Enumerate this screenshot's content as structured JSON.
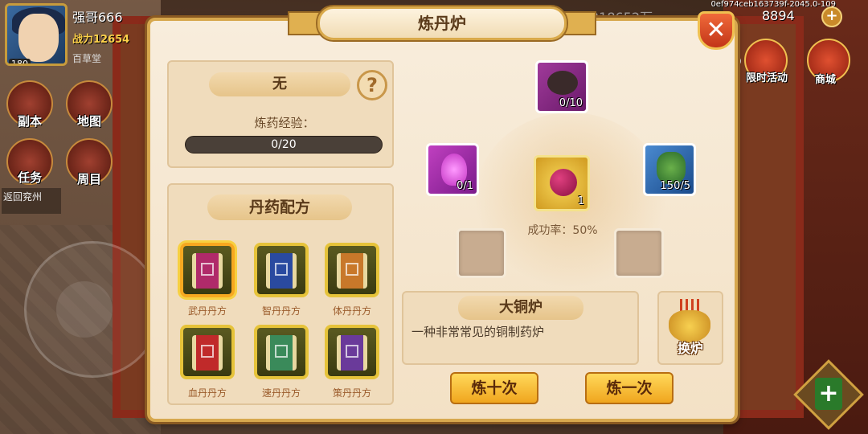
{
  "hud": {
    "player_name": "强哥666",
    "power_label": "战力12654",
    "guild": "百草堂",
    "level": "180",
    "debug_id": "0ef974ceb163739f-2045.0-109",
    "currency_1": "218652万",
    "currency_2": "8894",
    "return_label": "返回兖州",
    "side_buttons": [
      "副本",
      "地图",
      "任务",
      "周目"
    ],
    "right_buttons": [
      "限时活动",
      "商城"
    ]
  },
  "dialog": {
    "title": "炼丹炉",
    "close_icon": "close-icon",
    "current_recipe": "无",
    "help_icon": "?",
    "exp_label": "炼药经验：",
    "exp_value": "0/20",
    "exp_fraction": 0.0,
    "recipes_header": "丹药配方",
    "recipes": [
      {
        "label": "武丹丹方",
        "color": "#b02a6a",
        "selected": true
      },
      {
        "label": "智丹丹方",
        "color": "#2a4aa0",
        "selected": false
      },
      {
        "label": "体丹丹方",
        "color": "#c8782a",
        "selected": false
      },
      {
        "label": "血丹丹方",
        "color": "#c02a2a",
        "selected": false
      },
      {
        "label": "速丹丹方",
        "color": "#3a8a5a",
        "selected": false
      },
      {
        "label": "策丹丹方",
        "color": "#6a3a9a",
        "selected": false
      }
    ],
    "ingredients": {
      "top": {
        "count": "0/10",
        "icon": "ore-icon"
      },
      "left": {
        "count": "0/1",
        "icon": "purple-flame-icon"
      },
      "center": {
        "count": "1",
        "icon": "red-pill-icon"
      },
      "right": {
        "count": "150/5",
        "icon": "herb-icon"
      }
    },
    "success_rate": "成功率：50%",
    "furnace_name": "大铜炉",
    "furnace_desc": "一种非常常见的铜制药炉",
    "switch_label": "换炉",
    "btn_ten": "炼十次",
    "btn_one": "炼一次"
  }
}
